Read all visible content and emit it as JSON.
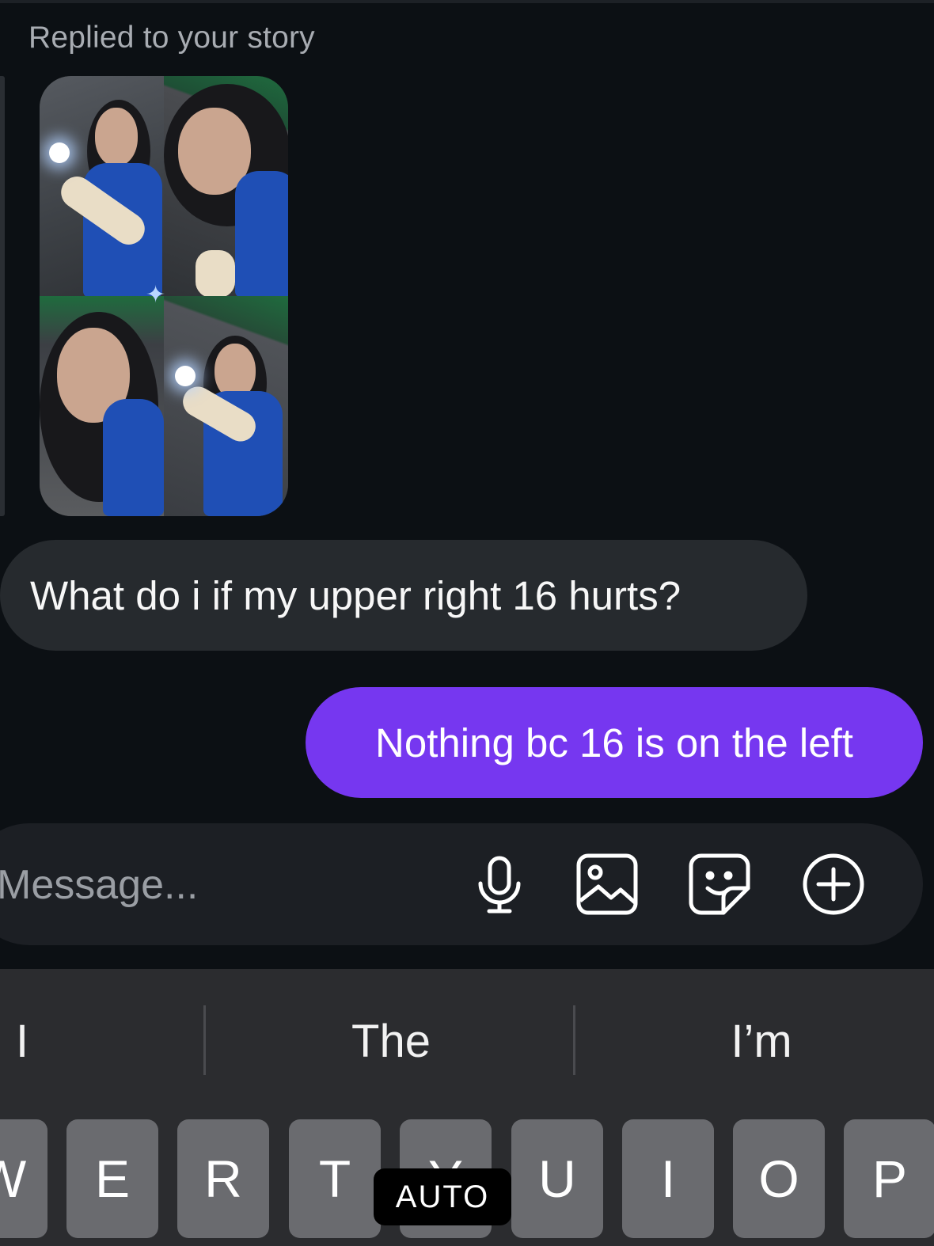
{
  "story_reply": {
    "label": "Replied to your story"
  },
  "messages": [
    {
      "direction": "incoming",
      "text": "What do i if my upper right 16 hurts?"
    },
    {
      "direction": "outgoing",
      "text": "Nothing bc 16 is on the left"
    }
  ],
  "composer": {
    "placeholder": "Message...",
    "icons": [
      "microphone-icon",
      "gallery-icon",
      "sticker-icon",
      "plus-icon"
    ]
  },
  "keyboard": {
    "suggestions": [
      "I",
      "The",
      "I’m"
    ],
    "keys": [
      "W",
      "E",
      "R",
      "T",
      "Y",
      "U",
      "I",
      "O",
      "P"
    ],
    "badge": "AUTO"
  },
  "colors": {
    "background": "#0c1014",
    "incoming_bubble": "#262a2e",
    "outgoing_bubble": "#7637f0",
    "keyboard": "#2b2c2f",
    "key": "#6a6b6f"
  }
}
